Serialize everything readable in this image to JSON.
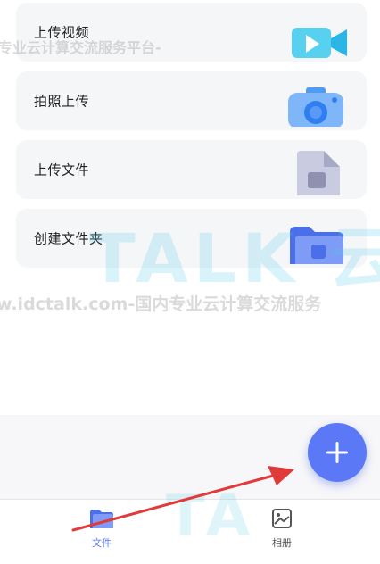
{
  "watermark": {
    "line1": "专业云计算交流服务平台-",
    "line2": "w.idctalk.com-国内专业云计算交流服务",
    "logo": "TALK 云"
  },
  "menu": [
    {
      "label": "上传视频",
      "icon": "video-icon"
    },
    {
      "label": "拍照上传",
      "icon": "camera-icon"
    },
    {
      "label": "上传文件",
      "icon": "file-icon"
    },
    {
      "label": "创建文件夹",
      "icon": "folder-icon"
    }
  ],
  "fab": {
    "symbol": "+",
    "icon": "plus-icon"
  },
  "tabs": [
    {
      "label": "文件",
      "icon": "folder-tab-icon",
      "active": true
    },
    {
      "label": "相册",
      "icon": "album-icon",
      "active": false
    }
  ],
  "colors": {
    "accent": "#5b78f6",
    "card_bg": "#f5f6f8",
    "tab_active": "#5b78f6",
    "tab_inactive": "#555555",
    "arrow": "#e03a3a"
  }
}
